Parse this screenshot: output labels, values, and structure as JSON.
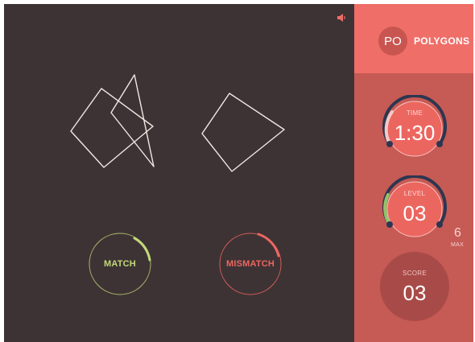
{
  "game": {
    "sound_icon": "speaker-icon",
    "left_shape": "polygon-pair",
    "right_shape": "quadrilateral",
    "match_label": "MATCH",
    "mismatch_label": "MISMATCH"
  },
  "panel": {
    "badge": "PO",
    "title": "POLYGONS",
    "time": {
      "label": "TIME",
      "value": "1:30"
    },
    "level": {
      "label": "LEVEL",
      "value": "03",
      "max_value": "6",
      "max_label": "MAX"
    },
    "score": {
      "label": "SCORE",
      "value": "03"
    }
  },
  "colors": {
    "board": "#3e3334",
    "panel": "#c65a55",
    "panel_header": "#ef6e68",
    "dial_face": "#ec6660",
    "dial_ring": "#2d3650",
    "match": "#c3d97a",
    "mismatch": "#ec6660",
    "score_bg": "#a84b48"
  }
}
